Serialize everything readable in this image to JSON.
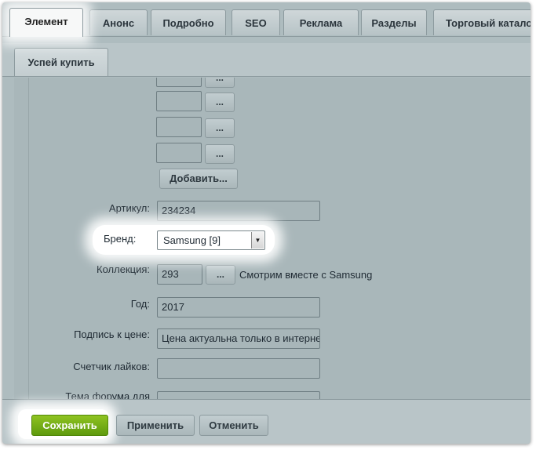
{
  "tabs": [
    {
      "label": "Элемент",
      "active": true
    },
    {
      "label": "Анонс"
    },
    {
      "label": "Подробно"
    },
    {
      "label": "SEO"
    },
    {
      "label": "Реклама"
    },
    {
      "label": "Разделы"
    },
    {
      "label": "Торговый каталог"
    }
  ],
  "subtabs": [
    {
      "label": "Успей купить"
    }
  ],
  "photo_list": {
    "more_label": "...",
    "add_label": "Добавить..."
  },
  "fields": {
    "article": {
      "label": "Артикул:",
      "value": "234234"
    },
    "brand": {
      "label": "Бренд:",
      "selected": "Samsung [9]"
    },
    "collection": {
      "label": "Коллекция:",
      "value": "293",
      "button": "...",
      "note": "Смотрим вместе с Samsung"
    },
    "year": {
      "label": "Год:",
      "value": "2017"
    },
    "price_caption": {
      "label": "Подпись к цене:",
      "value": "Цена актуальна только в интернет"
    },
    "likes_counter": {
      "label": "Счетчик лайков:",
      "value": ""
    },
    "forum_topic": {
      "label": "Тема форума для",
      "value": ""
    }
  },
  "footer": {
    "save": "Сохранить",
    "apply": "Применить",
    "cancel": "Отменить"
  },
  "colors": {
    "save_button": "#7ab51d",
    "background": "#aebcbf"
  }
}
